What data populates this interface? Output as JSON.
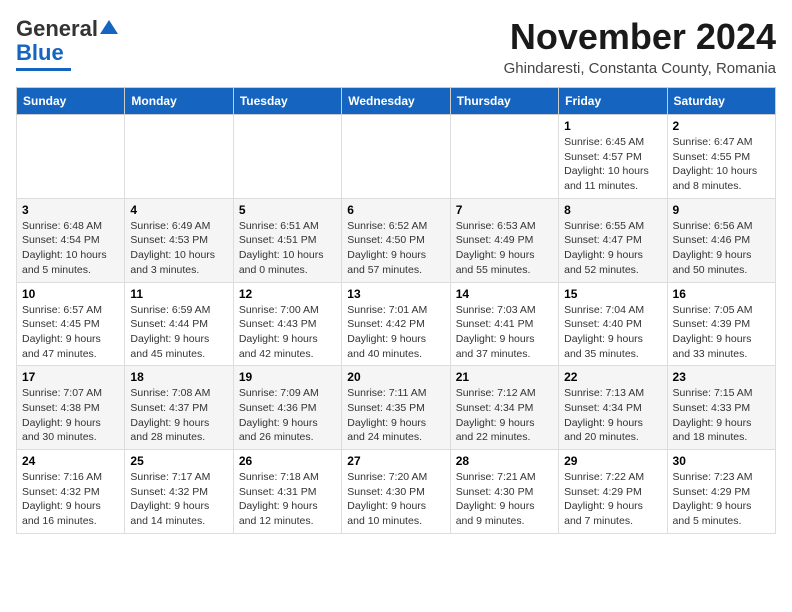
{
  "header": {
    "logo_general": "General",
    "logo_blue": "Blue",
    "month_title": "November 2024",
    "subtitle": "Ghindaresti, Constanta County, Romania"
  },
  "calendar": {
    "days_of_week": [
      "Sunday",
      "Monday",
      "Tuesday",
      "Wednesday",
      "Thursday",
      "Friday",
      "Saturday"
    ],
    "weeks": [
      [
        {
          "day": "",
          "info": ""
        },
        {
          "day": "",
          "info": ""
        },
        {
          "day": "",
          "info": ""
        },
        {
          "day": "",
          "info": ""
        },
        {
          "day": "",
          "info": ""
        },
        {
          "day": "1",
          "info": "Sunrise: 6:45 AM\nSunset: 4:57 PM\nDaylight: 10 hours and 11 minutes."
        },
        {
          "day": "2",
          "info": "Sunrise: 6:47 AM\nSunset: 4:55 PM\nDaylight: 10 hours and 8 minutes."
        }
      ],
      [
        {
          "day": "3",
          "info": "Sunrise: 6:48 AM\nSunset: 4:54 PM\nDaylight: 10 hours and 5 minutes."
        },
        {
          "day": "4",
          "info": "Sunrise: 6:49 AM\nSunset: 4:53 PM\nDaylight: 10 hours and 3 minutes."
        },
        {
          "day": "5",
          "info": "Sunrise: 6:51 AM\nSunset: 4:51 PM\nDaylight: 10 hours and 0 minutes."
        },
        {
          "day": "6",
          "info": "Sunrise: 6:52 AM\nSunset: 4:50 PM\nDaylight: 9 hours and 57 minutes."
        },
        {
          "day": "7",
          "info": "Sunrise: 6:53 AM\nSunset: 4:49 PM\nDaylight: 9 hours and 55 minutes."
        },
        {
          "day": "8",
          "info": "Sunrise: 6:55 AM\nSunset: 4:47 PM\nDaylight: 9 hours and 52 minutes."
        },
        {
          "day": "9",
          "info": "Sunrise: 6:56 AM\nSunset: 4:46 PM\nDaylight: 9 hours and 50 minutes."
        }
      ],
      [
        {
          "day": "10",
          "info": "Sunrise: 6:57 AM\nSunset: 4:45 PM\nDaylight: 9 hours and 47 minutes."
        },
        {
          "day": "11",
          "info": "Sunrise: 6:59 AM\nSunset: 4:44 PM\nDaylight: 9 hours and 45 minutes."
        },
        {
          "day": "12",
          "info": "Sunrise: 7:00 AM\nSunset: 4:43 PM\nDaylight: 9 hours and 42 minutes."
        },
        {
          "day": "13",
          "info": "Sunrise: 7:01 AM\nSunset: 4:42 PM\nDaylight: 9 hours and 40 minutes."
        },
        {
          "day": "14",
          "info": "Sunrise: 7:03 AM\nSunset: 4:41 PM\nDaylight: 9 hours and 37 minutes."
        },
        {
          "day": "15",
          "info": "Sunrise: 7:04 AM\nSunset: 4:40 PM\nDaylight: 9 hours and 35 minutes."
        },
        {
          "day": "16",
          "info": "Sunrise: 7:05 AM\nSunset: 4:39 PM\nDaylight: 9 hours and 33 minutes."
        }
      ],
      [
        {
          "day": "17",
          "info": "Sunrise: 7:07 AM\nSunset: 4:38 PM\nDaylight: 9 hours and 30 minutes."
        },
        {
          "day": "18",
          "info": "Sunrise: 7:08 AM\nSunset: 4:37 PM\nDaylight: 9 hours and 28 minutes."
        },
        {
          "day": "19",
          "info": "Sunrise: 7:09 AM\nSunset: 4:36 PM\nDaylight: 9 hours and 26 minutes."
        },
        {
          "day": "20",
          "info": "Sunrise: 7:11 AM\nSunset: 4:35 PM\nDaylight: 9 hours and 24 minutes."
        },
        {
          "day": "21",
          "info": "Sunrise: 7:12 AM\nSunset: 4:34 PM\nDaylight: 9 hours and 22 minutes."
        },
        {
          "day": "22",
          "info": "Sunrise: 7:13 AM\nSunset: 4:34 PM\nDaylight: 9 hours and 20 minutes."
        },
        {
          "day": "23",
          "info": "Sunrise: 7:15 AM\nSunset: 4:33 PM\nDaylight: 9 hours and 18 minutes."
        }
      ],
      [
        {
          "day": "24",
          "info": "Sunrise: 7:16 AM\nSunset: 4:32 PM\nDaylight: 9 hours and 16 minutes."
        },
        {
          "day": "25",
          "info": "Sunrise: 7:17 AM\nSunset: 4:32 PM\nDaylight: 9 hours and 14 minutes."
        },
        {
          "day": "26",
          "info": "Sunrise: 7:18 AM\nSunset: 4:31 PM\nDaylight: 9 hours and 12 minutes."
        },
        {
          "day": "27",
          "info": "Sunrise: 7:20 AM\nSunset: 4:30 PM\nDaylight: 9 hours and 10 minutes."
        },
        {
          "day": "28",
          "info": "Sunrise: 7:21 AM\nSunset: 4:30 PM\nDaylight: 9 hours and 9 minutes."
        },
        {
          "day": "29",
          "info": "Sunrise: 7:22 AM\nSunset: 4:29 PM\nDaylight: 9 hours and 7 minutes."
        },
        {
          "day": "30",
          "info": "Sunrise: 7:23 AM\nSunset: 4:29 PM\nDaylight: 9 hours and 5 minutes."
        }
      ]
    ]
  }
}
